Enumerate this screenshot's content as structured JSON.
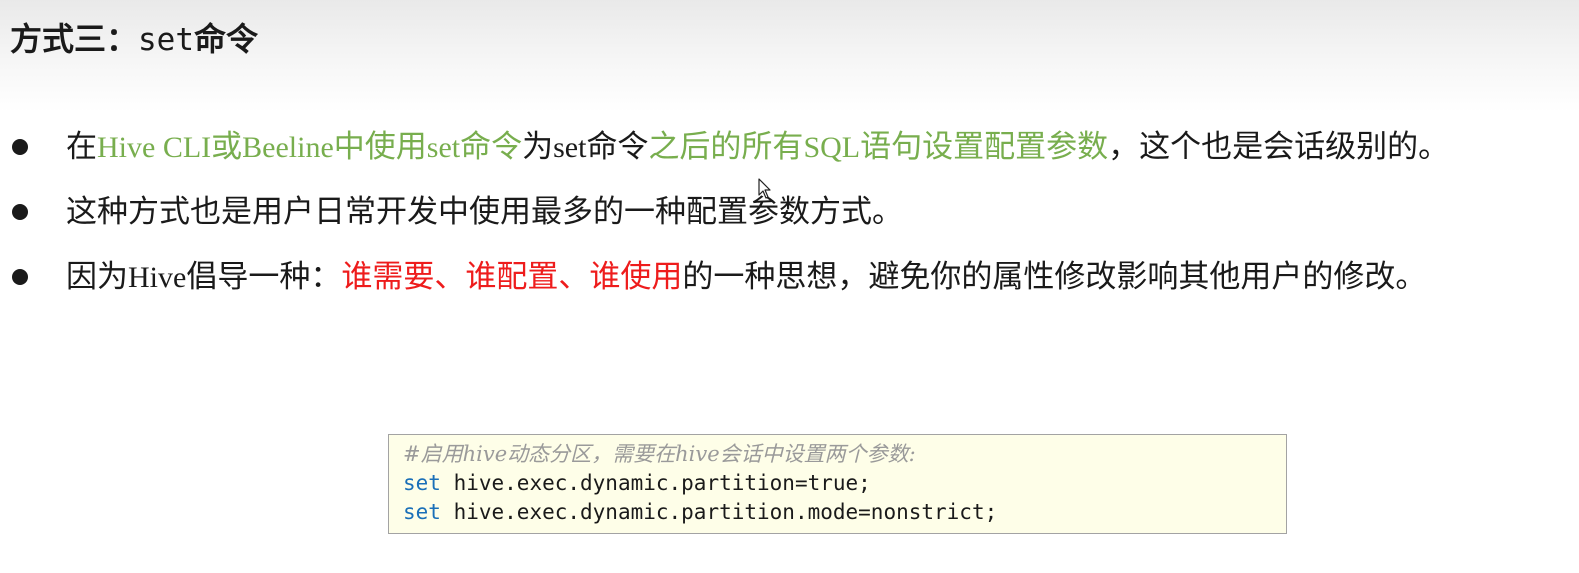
{
  "title": {
    "part1": "方式三：",
    "part2": "set",
    "part3": "命令"
  },
  "bullets": [
    {
      "segments": [
        {
          "text": "在",
          "style": "plain"
        },
        {
          "text": "Hive CLI",
          "style": "green-mono"
        },
        {
          "text": "或",
          "style": "green"
        },
        {
          "text": "Beeline",
          "style": "green-mono"
        },
        {
          "text": "中使用",
          "style": "green"
        },
        {
          "text": "set",
          "style": "green-mono"
        },
        {
          "text": "命令",
          "style": "green"
        },
        {
          "text": "为",
          "style": "plain"
        },
        {
          "text": "set",
          "style": "mono"
        },
        {
          "text": "命令",
          "style": "plain"
        },
        {
          "text": "之后的所有",
          "style": "green"
        },
        {
          "text": "SQL",
          "style": "green-mono"
        },
        {
          "text": "语句设置配置参数",
          "style": "green"
        },
        {
          "text": "，这个也是会话级别的。",
          "style": "plain"
        }
      ]
    },
    {
      "segments": [
        {
          "text": "这种方式也是用户日常开发中使用最多的一种配置参数方式。",
          "style": "plain"
        }
      ]
    },
    {
      "segments": [
        {
          "text": "因为",
          "style": "plain"
        },
        {
          "text": "Hive",
          "style": "mono"
        },
        {
          "text": "倡导一种：",
          "style": "plain"
        },
        {
          "text": "谁需要、谁配置、谁使用",
          "style": "red"
        },
        {
          "text": "的一种思想，避免你的属性修改影响其他用户的修改。",
          "style": "plain"
        }
      ]
    }
  ],
  "code": {
    "comment": "#启用hive动态分区，需要在hive会话中设置两个参数:",
    "lines": [
      {
        "keyword": "set",
        "rest": " hive.exec.dynamic.partition=true;"
      },
      {
        "keyword": "set",
        "rest": " hive.exec.dynamic.partition.mode=nonstrict;"
      }
    ]
  },
  "colors": {
    "green": "#78ae4e",
    "red": "#ee1c1c",
    "keyword": "#1a6fb8",
    "comment": "#9a9a9a",
    "code_bg": "#fefee8"
  },
  "icons": {
    "bullet": "bullet-dot-icon",
    "cursor": "mouse-pointer-icon"
  }
}
